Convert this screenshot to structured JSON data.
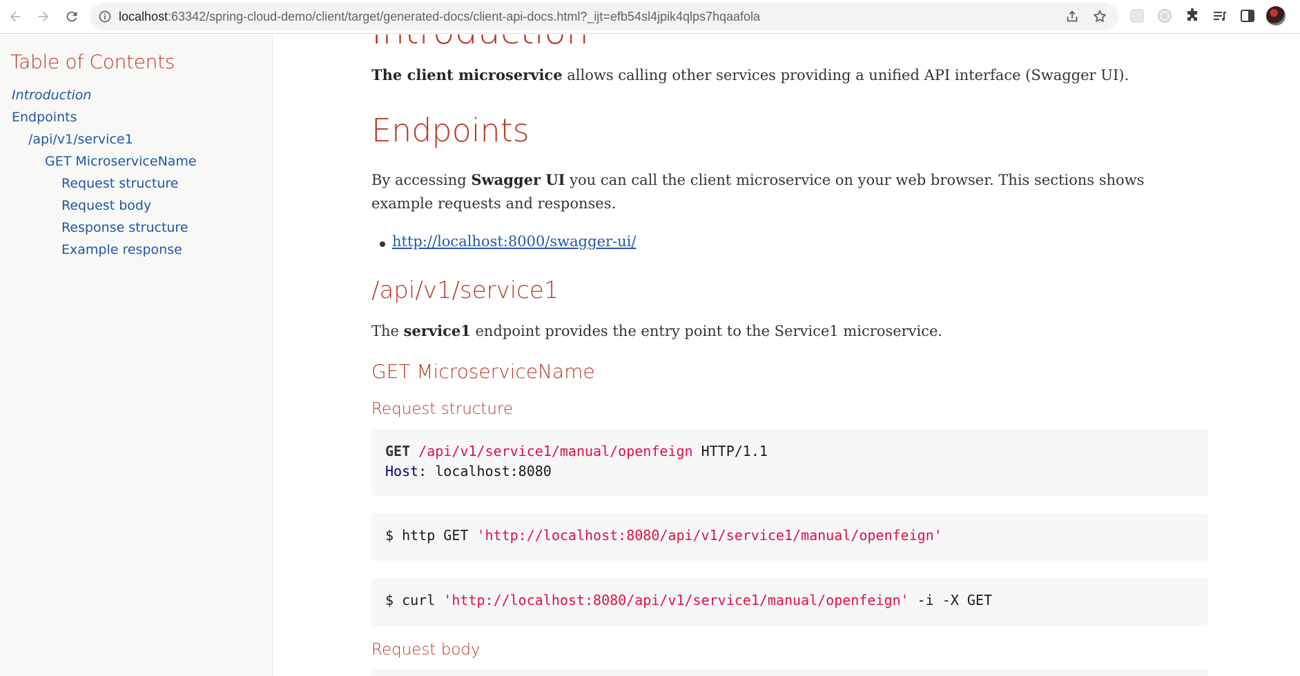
{
  "browser": {
    "url_host": "localhost",
    "url_rest": ":63342/spring-cloud-demo/client/target/generated-docs/client-api-docs.html?_ijt=efb54sl4jpik4qlps7hqaafola",
    "icons": [
      "back-icon",
      "forward-icon",
      "reload-icon",
      "info-icon",
      "share-icon",
      "star-icon",
      "extension-icon",
      "puzzle-icon",
      "playlist-icon",
      "side-panel-icon",
      "avatar"
    ]
  },
  "toc": {
    "title": "Table of Contents",
    "items": [
      {
        "label": "Introduction",
        "level": 1
      },
      {
        "label": "Endpoints",
        "level": 1
      },
      {
        "label": "/api/v1/service1",
        "level": 2
      },
      {
        "label": "GET MicroserviceName",
        "level": 3
      },
      {
        "label": "Request structure",
        "level": 4
      },
      {
        "label": "Request body",
        "level": 4
      },
      {
        "label": "Response structure",
        "level": 4
      },
      {
        "label": "Example response",
        "level": 4
      }
    ]
  },
  "content": {
    "intro_heading": "Introduction",
    "intro_bold": "The client microservice",
    "intro_text": " allows calling other services providing a unified API interface (Swagger UI).",
    "endpoints_heading": "Endpoints",
    "endpoints_text1": "By accessing ",
    "endpoints_bold": "Swagger UI",
    "endpoints_text2": " you can call the client microservice on your web browser. This sections shows example requests and responses.",
    "swagger_link": "http://localhost:8000/swagger-ui/",
    "service_heading": "/api/v1/service1",
    "service_text1": "The ",
    "service_bold": "service1",
    "service_text2": " endpoint provides the entry point to the Service1 microservice.",
    "get_heading": "GET MicroserviceName",
    "request_structure_heading": "Request structure",
    "request_line": {
      "method": "GET",
      "path": "/api/v1/service1/manual/openfeign",
      "version": " HTTP/1.1"
    },
    "host_line": {
      "name": "Host",
      "value": ": localhost:8080"
    },
    "httpie_cmd": {
      "prefix": "$ http GET ",
      "url": "'http://localhost:8080/api/v1/service1/manual/openfeign'"
    },
    "curl_cmd": {
      "prefix": "$ curl ",
      "url": "'http://localhost:8080/api/v1/service1/manual/openfeign'",
      "suffix": " -i -X GET"
    },
    "request_body_heading": "Request body"
  }
}
